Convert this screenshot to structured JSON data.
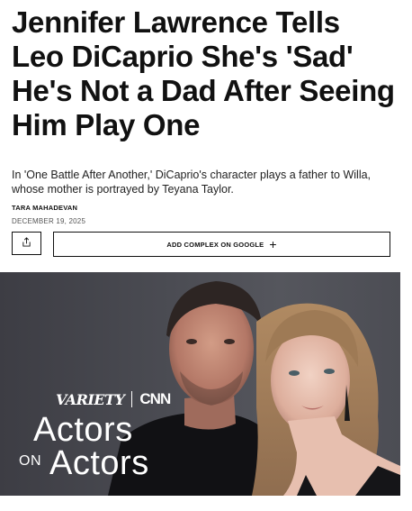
{
  "article": {
    "headline": "Jennifer Lawrence Tells Leo DiCaprio She's 'Sad' He's Not a Dad After Seeing Him Play One",
    "dek": "In 'One Battle After Another,' DiCaprio's character plays a father to Willa, whose mother is portrayed by Teyana Taylor.",
    "author": "TARA MAHADEVAN",
    "date": "DECEMBER 19, 2025"
  },
  "actions": {
    "share_icon": "share-icon",
    "google_label": "ADD COMPLEX ON GOOGLE",
    "google_icon": "plus-icon"
  },
  "hero": {
    "brand_variety": "VARIETY",
    "brand_cnn": "CNN",
    "series_line1": "Actors",
    "series_on": "ON",
    "series_line2": "Actors"
  }
}
